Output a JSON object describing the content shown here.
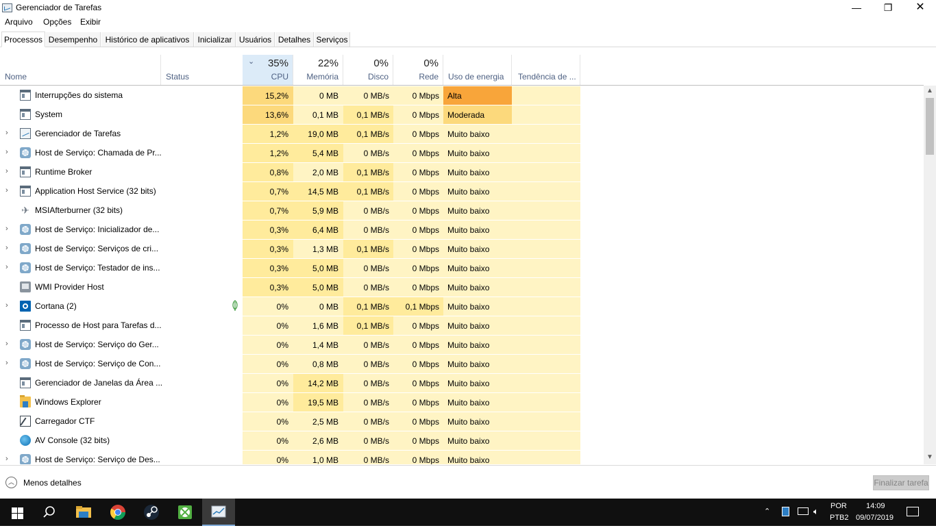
{
  "window": {
    "title": "Gerenciador de Tarefas",
    "minimize_glyph": "—",
    "maximize_glyph": "❐",
    "close_glyph": "✕"
  },
  "menu": [
    "Arquivo",
    "Opções",
    "Exibir"
  ],
  "tabs": [
    "Processos",
    "Desempenho",
    "Histórico de aplicativos",
    "Inicializar",
    "Usuários",
    "Detalhes",
    "Serviços"
  ],
  "active_tab": "Processos",
  "columns": {
    "name": "Nome",
    "status": "Status",
    "cpu": {
      "label": "CPU",
      "total": "35%"
    },
    "memory": {
      "label": "Memória",
      "total": "22%"
    },
    "disk": {
      "label": "Disco",
      "total": "0%"
    },
    "network": {
      "label": "Rede",
      "total": "0%"
    },
    "energy": {
      "label": "Uso de energia"
    },
    "trend": {
      "label": "Tendência de ..."
    }
  },
  "processes": [
    {
      "name": "Interrupções do sistema",
      "icon": "window-icon",
      "expandable": false,
      "cpu": "15,2%",
      "memory": "0 MB",
      "disk": "0 MB/s",
      "network": "0 Mbps",
      "energy": "Alta"
    },
    {
      "name": "System",
      "icon": "window-icon",
      "expandable": false,
      "cpu": "13,6%",
      "memory": "0,1 MB",
      "disk": "0,1 MB/s",
      "network": "0 Mbps",
      "energy": "Moderada"
    },
    {
      "name": "Gerenciador de Tarefas",
      "icon": "task-manager-icon",
      "expandable": true,
      "cpu": "1,2%",
      "memory": "19,0 MB",
      "disk": "0,1 MB/s",
      "network": "0 Mbps",
      "energy": "Muito baixo"
    },
    {
      "name": "Host de Serviço: Chamada de Pr...",
      "icon": "gear-icon",
      "expandable": true,
      "cpu": "1,2%",
      "memory": "5,4 MB",
      "disk": "0 MB/s",
      "network": "0 Mbps",
      "energy": "Muito baixo"
    },
    {
      "name": "Runtime Broker",
      "icon": "window-icon",
      "expandable": true,
      "cpu": "0,8%",
      "memory": "2,0 MB",
      "disk": "0,1 MB/s",
      "network": "0 Mbps",
      "energy": "Muito baixo"
    },
    {
      "name": "Application Host Service (32 bits)",
      "icon": "window-icon",
      "expandable": true,
      "cpu": "0,7%",
      "memory": "14,5 MB",
      "disk": "0,1 MB/s",
      "network": "0 Mbps",
      "energy": "Muito baixo"
    },
    {
      "name": "MSIAfterburner (32 bits)",
      "icon": "plane-icon",
      "expandable": false,
      "cpu": "0,7%",
      "memory": "5,9 MB",
      "disk": "0 MB/s",
      "network": "0 Mbps",
      "energy": "Muito baixo"
    },
    {
      "name": "Host de Serviço: Inicializador de...",
      "icon": "gear-icon",
      "expandable": true,
      "cpu": "0,3%",
      "memory": "6,4 MB",
      "disk": "0 MB/s",
      "network": "0 Mbps",
      "energy": "Muito baixo"
    },
    {
      "name": "Host de Serviço: Serviços de cri...",
      "icon": "gear-icon",
      "expandable": true,
      "cpu": "0,3%",
      "memory": "1,3 MB",
      "disk": "0,1 MB/s",
      "network": "0 Mbps",
      "energy": "Muito baixo"
    },
    {
      "name": "Host de Serviço: Testador de ins...",
      "icon": "gear-icon",
      "expandable": true,
      "cpu": "0,3%",
      "memory": "5,0 MB",
      "disk": "0 MB/s",
      "network": "0 Mbps",
      "energy": "Muito baixo"
    },
    {
      "name": "WMI Provider Host",
      "icon": "wmi-icon",
      "expandable": false,
      "cpu": "0,3%",
      "memory": "5,0 MB",
      "disk": "0 MB/s",
      "network": "0 Mbps",
      "energy": "Muito baixo"
    },
    {
      "name": "Cortana (2)",
      "icon": "cortana-icon",
      "expandable": true,
      "status_leaf": true,
      "cpu": "0%",
      "memory": "0 MB",
      "disk": "0,1 MB/s",
      "network": "0,1 Mbps",
      "energy": "Muito baixo"
    },
    {
      "name": "Processo de Host para Tarefas d...",
      "icon": "window-icon",
      "expandable": false,
      "cpu": "0%",
      "memory": "1,6 MB",
      "disk": "0,1 MB/s",
      "network": "0 Mbps",
      "energy": "Muito baixo"
    },
    {
      "name": "Host de Serviço: Serviço do Ger...",
      "icon": "gear-icon",
      "expandable": true,
      "cpu": "0%",
      "memory": "1,4 MB",
      "disk": "0 MB/s",
      "network": "0 Mbps",
      "energy": "Muito baixo"
    },
    {
      "name": "Host de Serviço: Serviço de Con...",
      "icon": "gear-icon",
      "expandable": true,
      "cpu": "0%",
      "memory": "0,8 MB",
      "disk": "0 MB/s",
      "network": "0 Mbps",
      "energy": "Muito baixo"
    },
    {
      "name": "Gerenciador de Janelas da Área ...",
      "icon": "window-icon",
      "expandable": false,
      "cpu": "0%",
      "memory": "14,2 MB",
      "disk": "0 MB/s",
      "network": "0 Mbps",
      "energy": "Muito baixo"
    },
    {
      "name": "Windows Explorer",
      "icon": "folder-icon",
      "expandable": false,
      "cpu": "0%",
      "memory": "19,5 MB",
      "disk": "0 MB/s",
      "network": "0 Mbps",
      "energy": "Muito baixo"
    },
    {
      "name": "Carregador CTF",
      "icon": "ctf-icon",
      "expandable": false,
      "cpu": "0%",
      "memory": "2,5 MB",
      "disk": "0 MB/s",
      "network": "0 Mbps",
      "energy": "Muito baixo"
    },
    {
      "name": "AV Console (32 bits)",
      "icon": "av-icon",
      "expandable": false,
      "cpu": "0%",
      "memory": "2,6 MB",
      "disk": "0 MB/s",
      "network": "0 Mbps",
      "energy": "Muito baixo"
    },
    {
      "name": "Host de Serviço: Serviço de Des...",
      "icon": "gear-icon",
      "expandable": true,
      "cpu": "0%",
      "memory": "1,0 MB",
      "disk": "0 MB/s",
      "network": "0 Mbps",
      "energy": "Muito baixo"
    }
  ],
  "footer": {
    "less_details": "Menos detalhes",
    "end_task": "Finalizar tarefa"
  },
  "taskbar": {
    "pinned": [
      "start-icon",
      "search-icon",
      "file-explorer-icon",
      "chrome-icon",
      "steam-icon",
      "xbox-icon",
      "task-manager-icon"
    ],
    "language": "POR",
    "keyboard": "PTB2",
    "time": "14:09",
    "date": "09/07/2019"
  },
  "colors": {
    "cpu_high": "#f8a53a",
    "cpu_medium": "#fcd97c",
    "cell_low": "#fff4c4",
    "cell_mid": "#ffeb9c",
    "energy_high": "#f8a53a",
    "energy_medium": "#fcd97c",
    "header_label": "#4d6082",
    "taskbar": "#101010"
  }
}
